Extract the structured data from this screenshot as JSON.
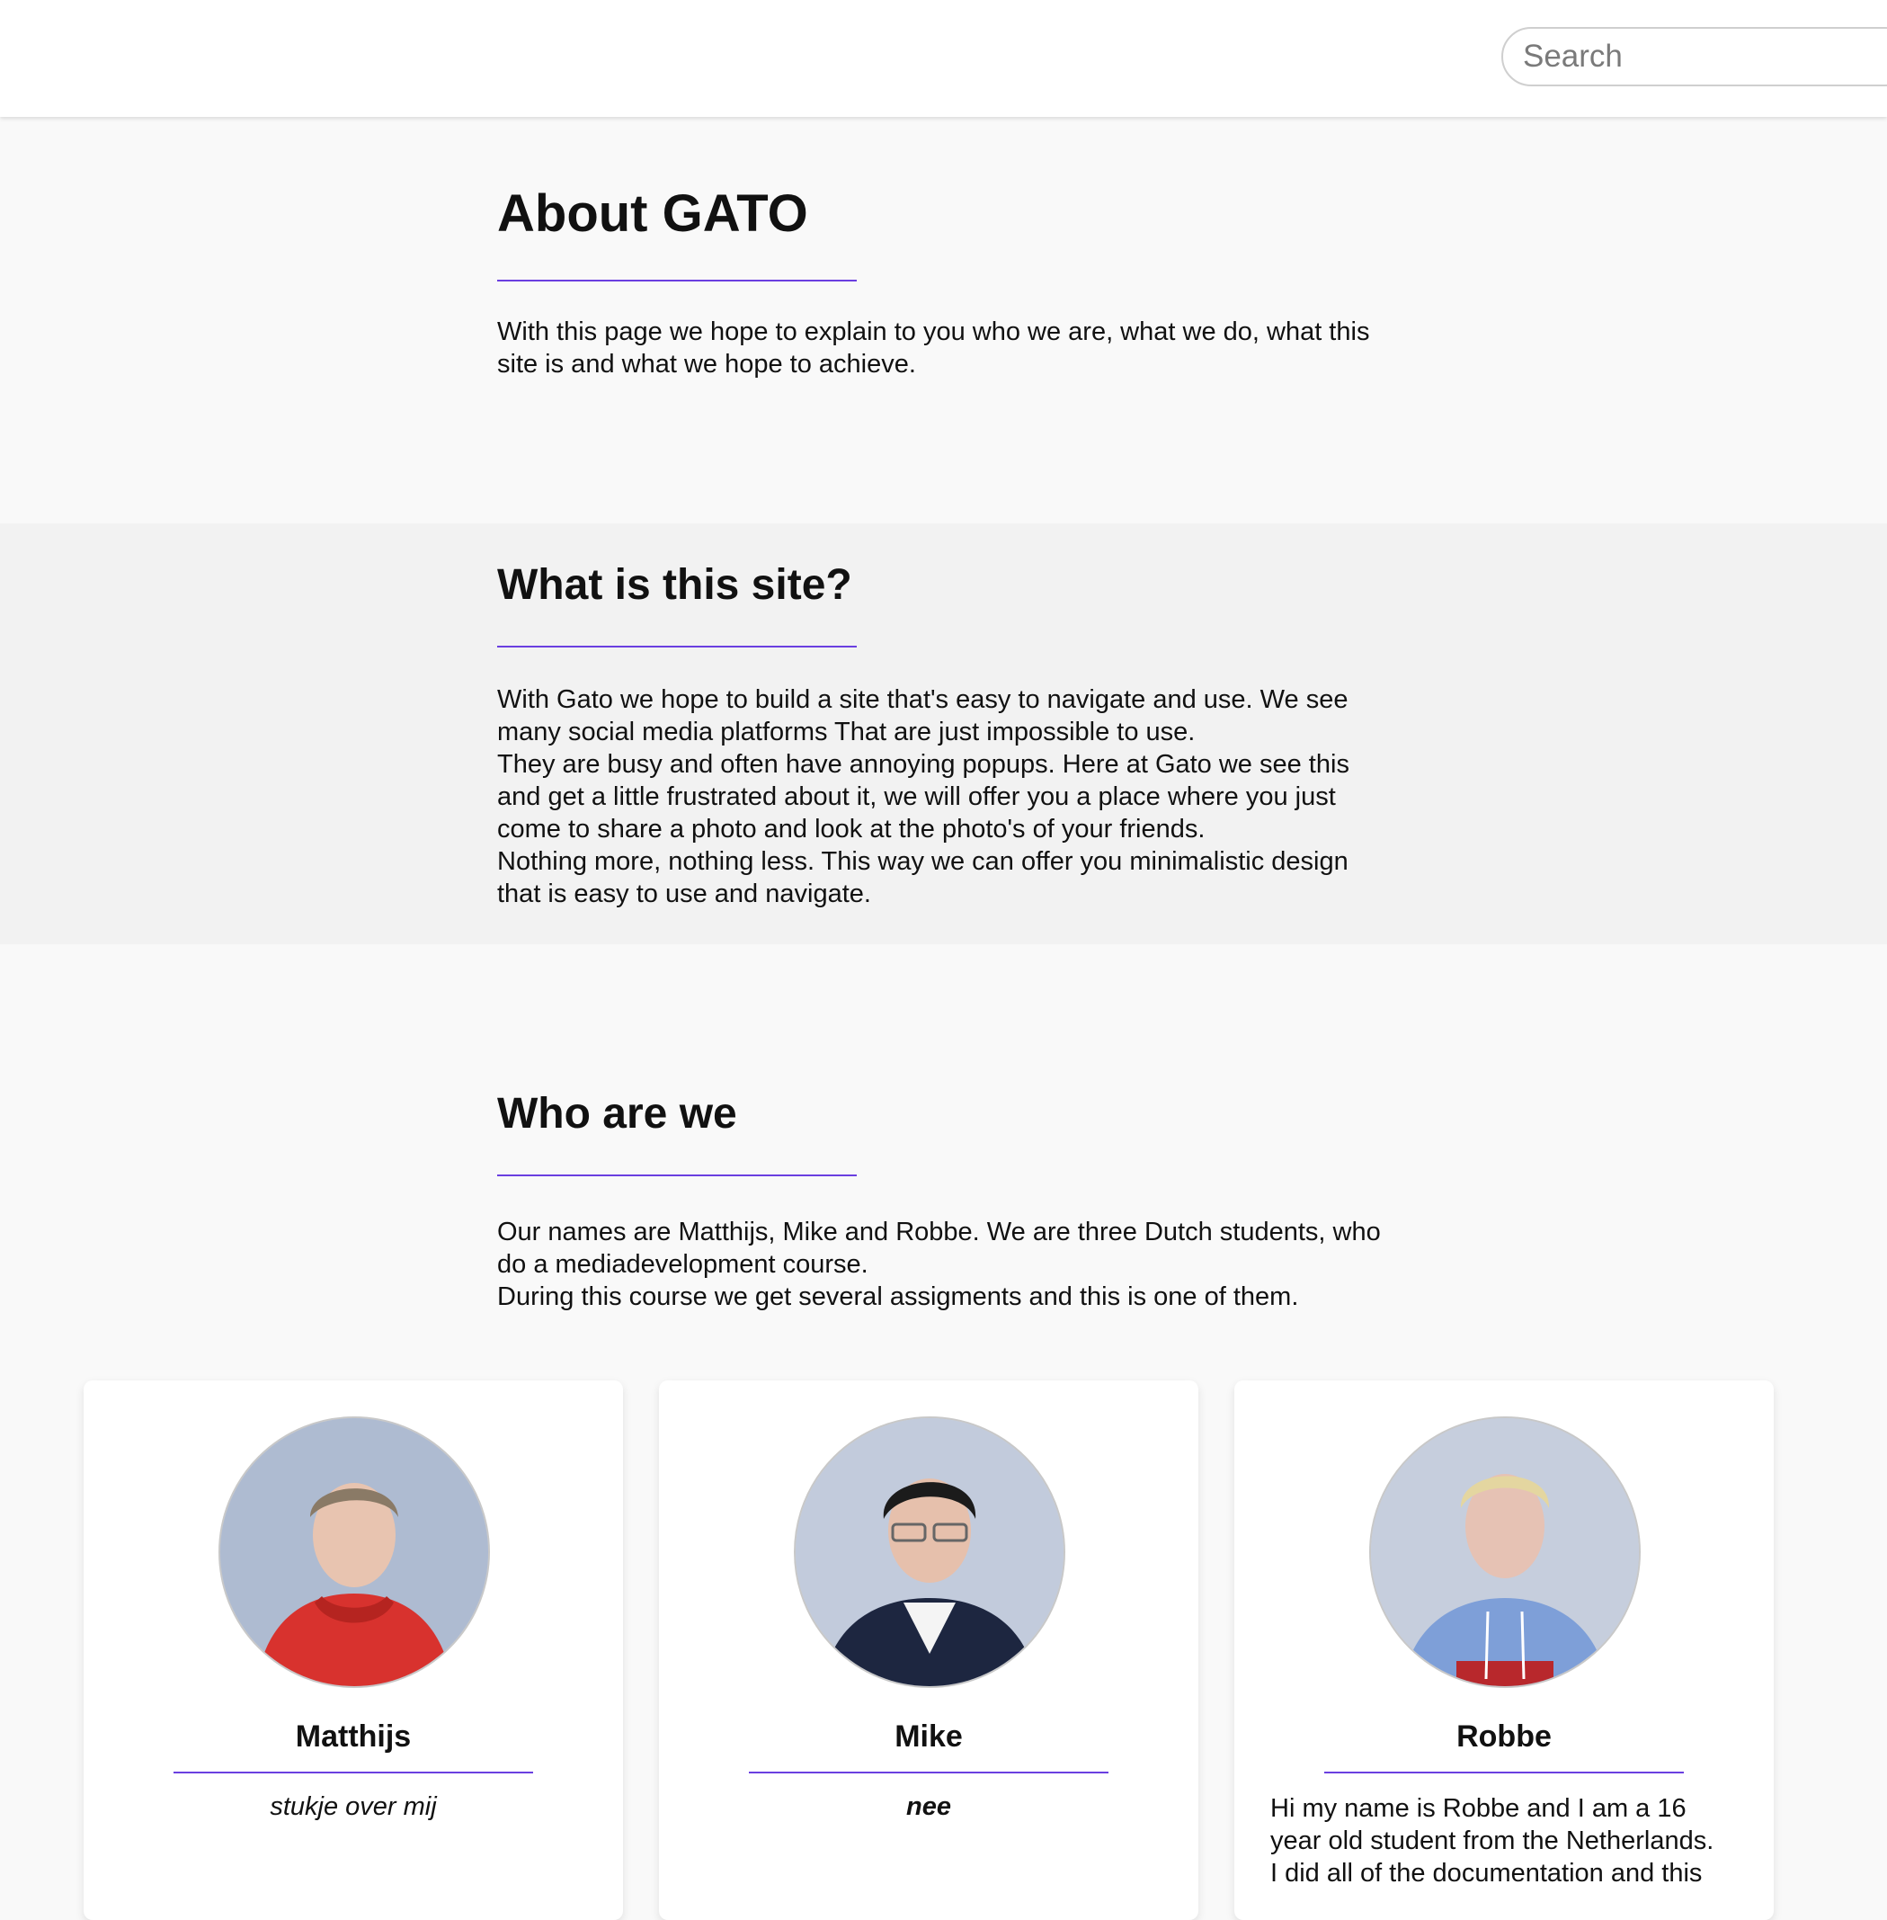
{
  "header": {
    "search_placeholder": "Search"
  },
  "about": {
    "title": "About GATO",
    "text": "With this page we hope to explain to you who we are, what we do, what this\nsite is and what we hope to achieve."
  },
  "what": {
    "title": "What is this site?",
    "text": "With Gato we hope to build a site that's easy to navigate and use. We see\nmany social media platforms That are just impossible to use.\nThey are busy and often have annoying popups. Here at Gato we see this\nand get a little frustrated about it, we will offer you a place where you just\ncome to share a photo and look at the photo's of your friends.\nNothing more, nothing less. This way we can offer you minimalistic design\nthat is easy to use and navigate."
  },
  "who": {
    "title": "Who are we",
    "text": "Our names are Matthijs, Mike and Robbe. We are three Dutch students, who\ndo a mediadevelopment course.\nDuring this course we get several assigments and this is one of them."
  },
  "team": [
    {
      "name": "Matthijs",
      "bio": "stukje over mij"
    },
    {
      "name": "Mike",
      "bio": "nee"
    },
    {
      "name": "Robbe",
      "bio": "Hi my name is Robbe and I am a 16\nyear old student from the Netherlands.\nI did all of the documentation and this"
    }
  ],
  "colors": {
    "accent": "#6a3fe0",
    "band": "#f2f2f2",
    "page": "#f9f9f9"
  }
}
